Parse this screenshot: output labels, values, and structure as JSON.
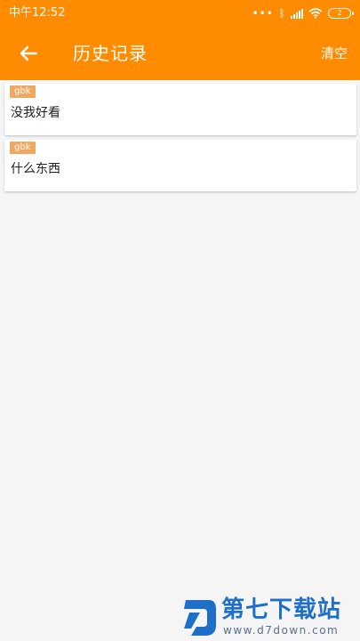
{
  "status_bar": {
    "time": "中午12:52",
    "battery": "2"
  },
  "app_bar": {
    "title": "历史记录",
    "clear_label": "清空",
    "back_icon": "arrow-left-icon",
    "background": "#ff8c00"
  },
  "history": [
    {
      "tag": "gbk",
      "text": "没我好看"
    },
    {
      "tag": "gbk",
      "text": "什么东西"
    }
  ],
  "watermark": {
    "title": "第七下载站",
    "url": "www.d7down.com"
  },
  "colors": {
    "accent": "#ff8c00",
    "tag": "#f0a860",
    "page_bg": "#f5f5f5"
  }
}
